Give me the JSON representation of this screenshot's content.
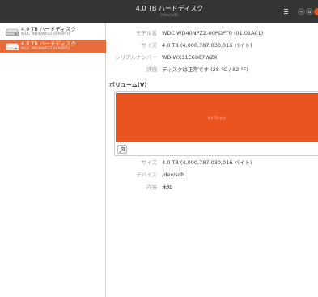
{
  "window": {
    "title": "4.0 TB ハードディスク",
    "subtitle": "/dev/sdb"
  },
  "sidebar": {
    "drives": [
      {
        "name": "4.0 TB ハードディスク",
        "model": "WDC WD40NPZZ-00PDPT0",
        "selected": false,
        "icon": "hard-disk-icon"
      },
      {
        "name": "4.0 TB ハードディスク",
        "model": "WDC WD40NPZZ-00PDPT0",
        "selected": true,
        "icon": "hard-disk-icon"
      }
    ]
  },
  "drive_info": {
    "model_label": "モデル名",
    "model_value": "WDC WD40NPZZ-00PDPT0 (01.01A01)",
    "size_label": "サイズ",
    "size_value": "4.0 TB (4,000,787,030,016 バイト)",
    "serial_label": "シリアルナンバー",
    "serial_value": "WD-WX31E6987WZX",
    "assessment_label": "評価",
    "assessment_value": "ディスクは正常です (28 °C / 82 °F)"
  },
  "volumes": {
    "title": "ボリューム(V)",
    "box_label": "4.0 TB 空き",
    "partition_size_label": "サイズ",
    "partition_size_value": "4.0 TB (4,000,787,030,016 バイト)",
    "device_label": "デバイス",
    "device_value": "/dev/sdb",
    "contents_label": "内容",
    "contents_value": "未知"
  },
  "colors": {
    "accent": "#e95420",
    "selection": "#e96d3b",
    "titlebar": "#353535"
  }
}
